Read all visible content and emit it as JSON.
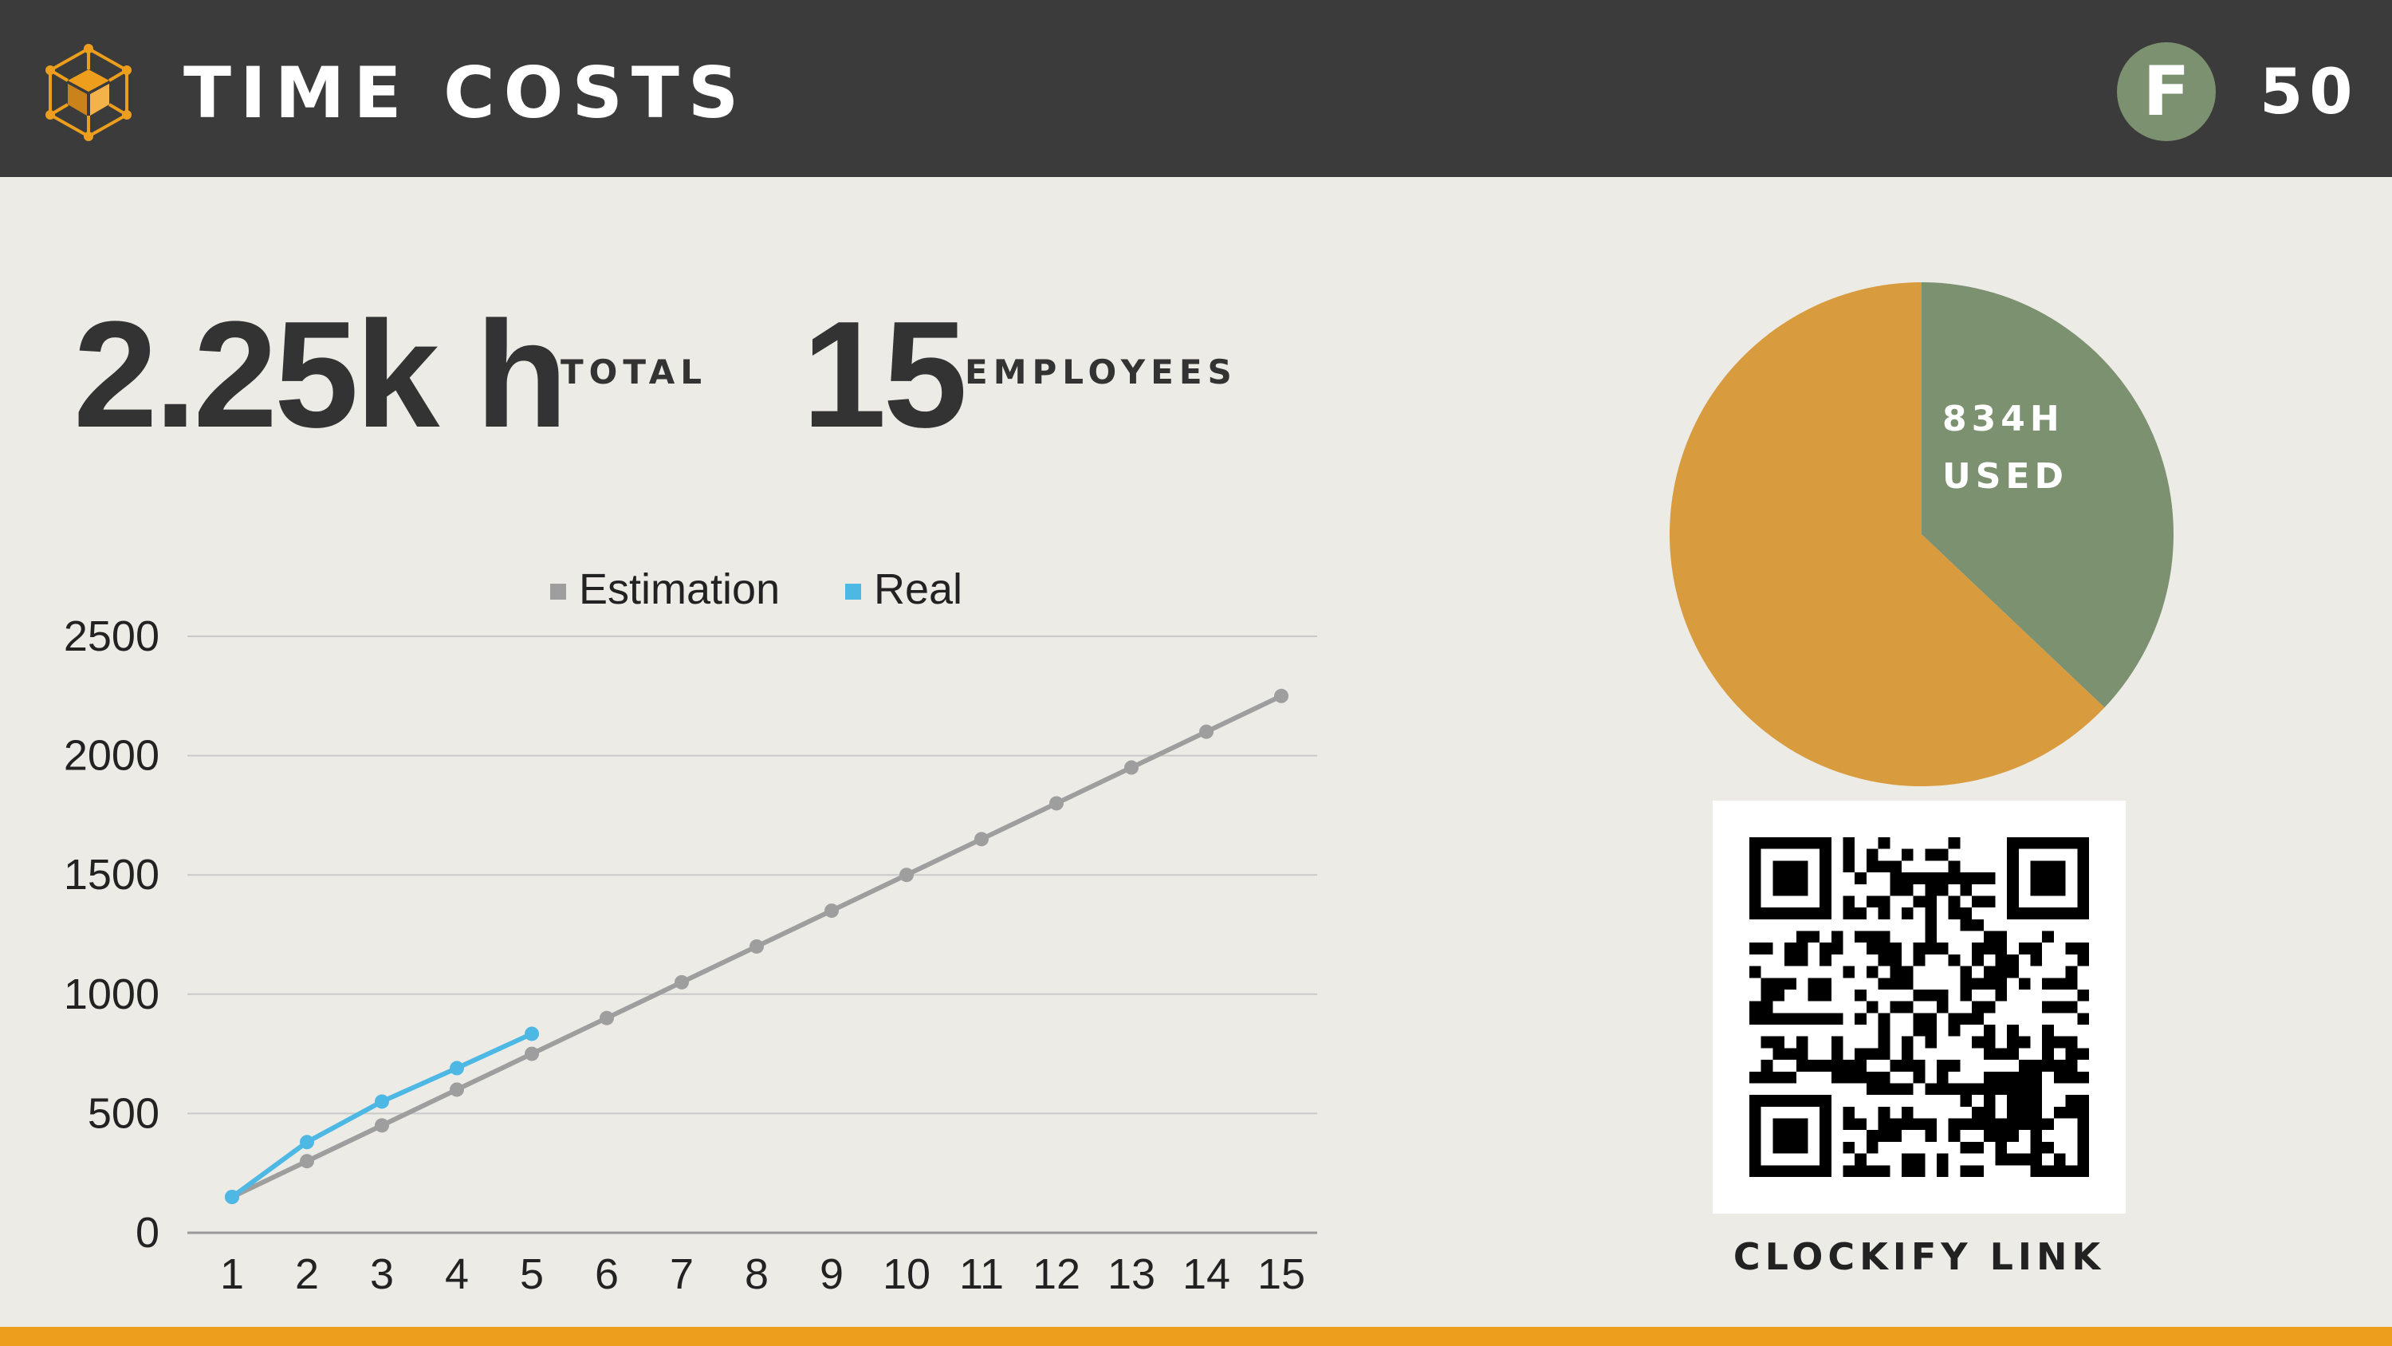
{
  "header": {
    "title": "TIME COSTS",
    "logo_icon": "cube-network-icon",
    "badge_letter": "F",
    "slide_number": "50",
    "background_color": "#3b3b3b",
    "badge_color": "#7b9170"
  },
  "stats": [
    {
      "value": "2.25k h",
      "label": "TOTAL"
    },
    {
      "value": "15",
      "label": "EMPLOYEES"
    }
  ],
  "colors": {
    "background": "#ecebe6",
    "estimation": "#9e9e9e",
    "real": "#4eb8e4",
    "pie_used": "#7b9170",
    "pie_remaining": "#d89b3e",
    "accent_bar": "#ec9e1c"
  },
  "chart_data": [
    {
      "type": "line",
      "x": [
        1,
        2,
        3,
        4,
        5,
        6,
        7,
        8,
        9,
        10,
        11,
        12,
        13,
        14,
        15
      ],
      "categories": [
        "1",
        "2",
        "3",
        "4",
        "5",
        "6",
        "7",
        "8",
        "9",
        "10",
        "11",
        "12",
        "13",
        "14",
        "15"
      ],
      "series": [
        {
          "name": "Estimation",
          "values": [
            150,
            300,
            450,
            600,
            750,
            900,
            1050,
            1200,
            1350,
            1500,
            1650,
            1800,
            1950,
            2100,
            2250
          ]
        },
        {
          "name": "Real",
          "values": [
            150,
            380,
            550,
            690,
            834
          ]
        }
      ],
      "ylim": [
        0,
        2500
      ],
      "yticks": [
        0,
        500,
        1000,
        1500,
        2000,
        2500
      ],
      "grid": true,
      "legend": "top"
    },
    {
      "type": "pie",
      "slices": [
        {
          "label": "834H USED",
          "value": 834,
          "color": "#7b9170"
        },
        {
          "label": "",
          "value": 1416,
          "color": "#d89b3e"
        }
      ],
      "annotation_lines": [
        "834H",
        "USED"
      ]
    }
  ],
  "qr": {
    "caption": "CLOCKIFY LINK",
    "icon": "qr-code-icon"
  }
}
